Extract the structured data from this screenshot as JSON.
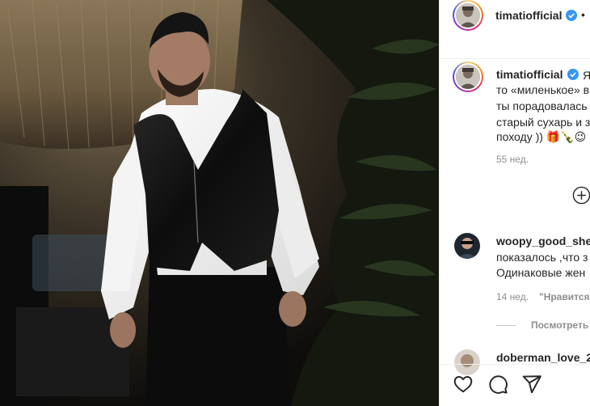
{
  "post": {
    "author": "timatiofficial",
    "separator": "•"
  },
  "caption": {
    "username": "timatiofficial",
    "lines": [
      "Я",
      "то «миленькое» в",
      "ты порадовалась",
      "старый сухарь и з",
      "походу )) 🎁🍾😉"
    ],
    "time": "55 нед."
  },
  "comments": [
    {
      "username": "woopy_good_she",
      "lines": [
        "показалось ,что з",
        "Одинаковые жен"
      ],
      "time": "14 нед.",
      "like_label": "\"Нравится\"",
      "replies_label": "Посмотреть"
    },
    {
      "username": "doberman_love_2"
    }
  ],
  "colors": {
    "verified": "#3897f0",
    "muted": "#8e8e8e",
    "text": "#262626"
  },
  "icons": {
    "like": "heart-icon",
    "comment": "comment-bubble-icon",
    "share": "paper-plane-icon",
    "load_more": "plus-circle-icon",
    "verified": "verified-badge-icon"
  }
}
